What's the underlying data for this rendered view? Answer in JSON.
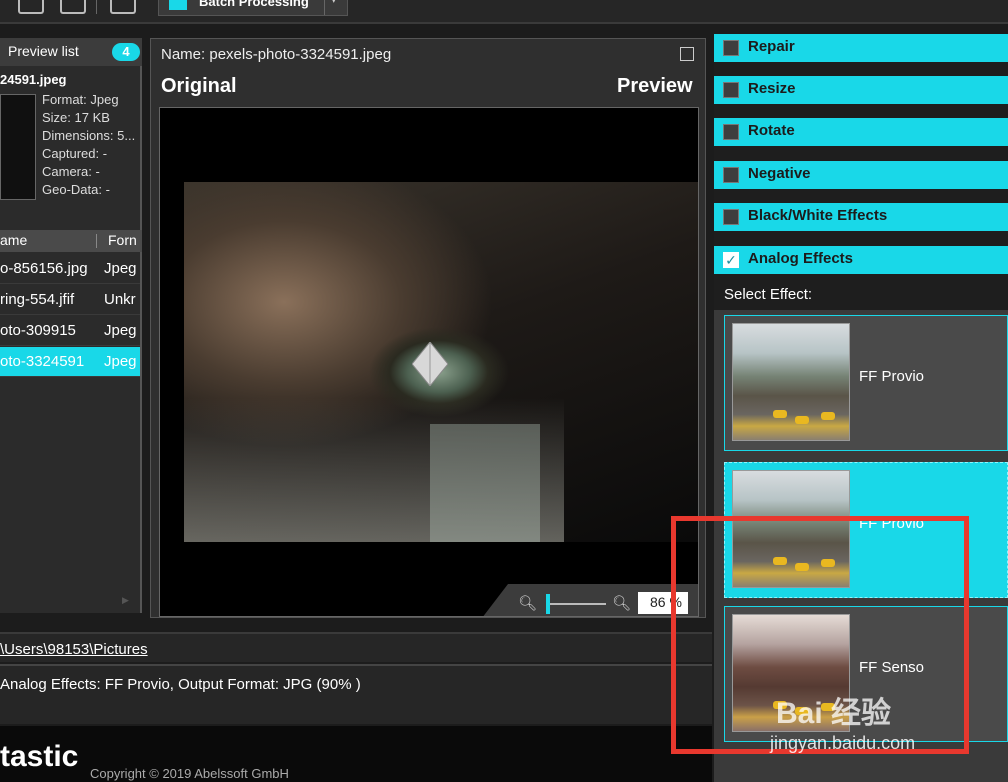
{
  "toolbar": {
    "batch_label": "Batch Processing"
  },
  "preview_list": {
    "title": "Preview list",
    "count": "4",
    "selected_name": "24591.jpeg",
    "meta": [
      "Format: Jpeg",
      "Size: 17 KB",
      "Dimensions: 5...",
      "Captured: -",
      "Camera: -",
      "Geo-Data: -"
    ],
    "columns": {
      "name": "ame",
      "format": "Forn"
    },
    "rows": [
      {
        "name": "o-856156.jpg",
        "format": "Jpeg",
        "selected": false
      },
      {
        "name": "ring-554.jfif",
        "format": "Unkr",
        "selected": false
      },
      {
        "name": "oto-309915",
        "format": "Jpeg",
        "selected": false
      },
      {
        "name": "oto-3324591",
        "format": "Jpeg",
        "selected": true
      }
    ]
  },
  "viewer": {
    "name_label": "Name: pexels-photo-3324591.jpeg",
    "original_label": "Original",
    "preview_label": "Preview",
    "zoom_value": "86 %"
  },
  "status": {
    "path": "\\Users\\98153\\Pictures",
    "summary": "Analog Effects: FF Provio, Output Format: JPG (90% )"
  },
  "footer": {
    "brand": "tastic",
    "copyright": "Copyright © 2019 Abelssoft GmbH"
  },
  "effects_panel": {
    "categories": [
      {
        "label": "Repair",
        "checked": false
      },
      {
        "label": "Resize",
        "checked": false
      },
      {
        "label": "Rotate",
        "checked": false
      },
      {
        "label": "Negative",
        "checked": false
      },
      {
        "label": "Black/White Effects",
        "checked": false
      },
      {
        "label": "Analog Effects",
        "checked": true
      }
    ],
    "select_label": "Select Effect:",
    "effects": [
      {
        "label": "FF Provio",
        "selected": false
      },
      {
        "label": "FF Provio",
        "selected": true
      },
      {
        "label": "FF Senso",
        "selected": false
      }
    ]
  },
  "watermark": {
    "logo": "Bai 经验",
    "url": "jingyan.baidu.com"
  },
  "colors": {
    "accent": "#19d8e8",
    "highlight": "#e8382e"
  }
}
